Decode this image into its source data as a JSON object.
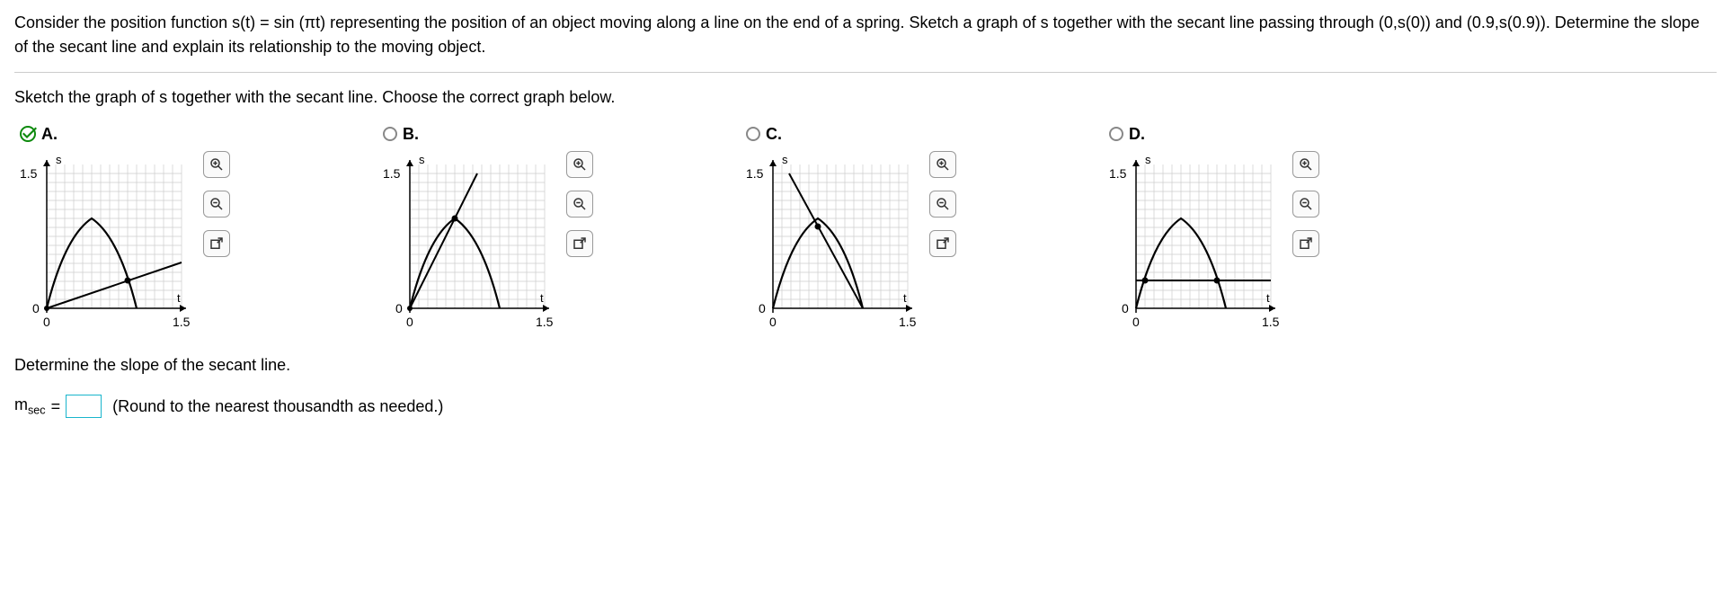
{
  "problem": "Consider the position function s(t) = sin (πt) representing the position of an object moving along a line on the end of a spring. Sketch a graph of s together with the secant line passing through (0,s(0)) and (0.9,s(0.9)). Determine the slope of the secant line and explain its relationship to the moving object.",
  "instruction": "Sketch the graph of s together with the secant line. Choose the correct graph below.",
  "options": [
    {
      "label": "A.",
      "selected": true,
      "axis_y_label": "s",
      "axis_x_label": "t",
      "y_tick": "1.5",
      "x_origin": "0",
      "x_tick": "1.5",
      "y_origin": "0"
    },
    {
      "label": "B.",
      "selected": false,
      "axis_y_label": "s",
      "axis_x_label": "t",
      "y_tick": "1.5",
      "x_origin": "0",
      "x_tick": "1.5",
      "y_origin": "0"
    },
    {
      "label": "C.",
      "selected": false,
      "axis_y_label": "s",
      "axis_x_label": "t",
      "y_tick": "1.5",
      "x_origin": "0",
      "x_tick": "1.5",
      "y_origin": "0"
    },
    {
      "label": "D.",
      "selected": false,
      "axis_y_label": "s",
      "axis_x_label": "t",
      "y_tick": "1.5",
      "x_origin": "0",
      "x_tick": "1.5",
      "y_origin": "0"
    }
  ],
  "slope_prompt": "Determine the slope of the secant line.",
  "slope_var_prefix": "m",
  "slope_var_sub": "sec",
  "slope_eq": " = ",
  "slope_round_note": "(Round to the nearest thousandth as needed.)",
  "chart_data": [
    {
      "type": "line",
      "title": "Option A",
      "xlim": [
        0,
        2
      ],
      "ylim": [
        -0.2,
        1.5
      ],
      "xlabel": "t",
      "ylabel": "s",
      "curve": "s = sin(pi*t) for t in [0,1]",
      "secant": {
        "points": [
          [
            0,
            0
          ],
          [
            0.9,
            0.309
          ]
        ],
        "slope": 0.343,
        "extended": true
      }
    },
    {
      "type": "line",
      "title": "Option B",
      "xlim": [
        0,
        2
      ],
      "ylim": [
        -0.2,
        1.5
      ],
      "xlabel": "t",
      "ylabel": "s",
      "curve": "s = sin(pi*t) for t in [0,1]",
      "secant": {
        "points": [
          [
            0,
            0
          ],
          [
            0.5,
            1.0
          ]
        ],
        "slope": 2.0,
        "extended": true
      }
    },
    {
      "type": "line",
      "title": "Option C",
      "xlim": [
        0,
        2
      ],
      "ylim": [
        -0.2,
        1.5
      ],
      "xlabel": "t",
      "ylabel": "s",
      "curve": "s = sin(pi*t) for t in [0,1]",
      "secant": {
        "points": [
          [
            0.1,
            1.5
          ],
          [
            1,
            0
          ]
        ],
        "slope": -1.667,
        "extended": true
      }
    },
    {
      "type": "line",
      "title": "Option D",
      "xlim": [
        0,
        2
      ],
      "ylim": [
        -0.2,
        1.5
      ],
      "xlabel": "t",
      "ylabel": "s",
      "curve": "s = sin(pi*t) for t in [0,1]",
      "secant": {
        "points": [
          [
            0,
            0.309
          ],
          [
            1.8,
            0.309
          ]
        ],
        "slope": 0.0,
        "extended": true
      }
    }
  ]
}
